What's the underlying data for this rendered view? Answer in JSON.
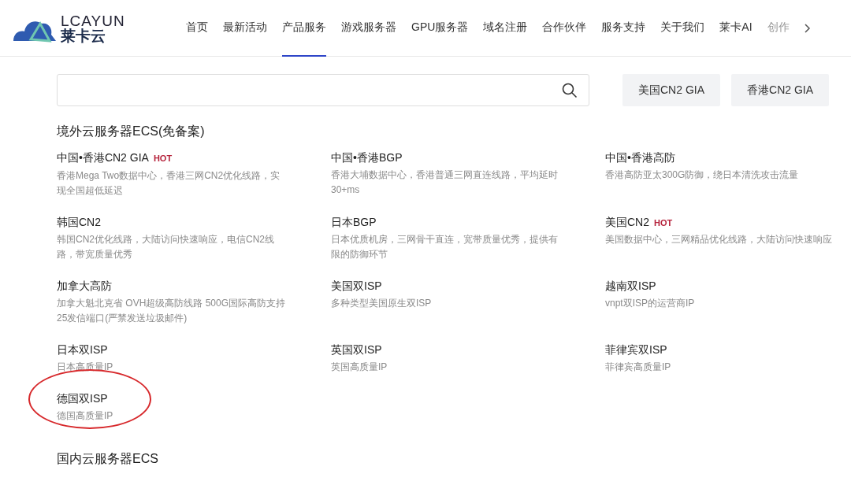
{
  "logo": {
    "latin": "LCAYUN",
    "chinese": "莱卡云"
  },
  "nav": [
    {
      "label": "首页",
      "selected": false
    },
    {
      "label": "最新活动",
      "selected": false
    },
    {
      "label": "产品服务",
      "selected": true
    },
    {
      "label": "游戏服务器",
      "selected": false
    },
    {
      "label": "GPU服务器",
      "selected": false
    },
    {
      "label": "域名注册",
      "selected": false
    },
    {
      "label": "合作伙伴",
      "selected": false
    },
    {
      "label": "服务支持",
      "selected": false
    },
    {
      "label": "关于我们",
      "selected": false
    },
    {
      "label": "莱卡AI",
      "selected": false
    },
    {
      "label": "创作",
      "selected": false
    }
  ],
  "search": {
    "quick_links": [
      "美国CN2 GIA",
      "香港CN2 GIA"
    ]
  },
  "sections": [
    {
      "title": "境外云服务器ECS(免备案)",
      "products": [
        {
          "name": "中国•香港CN2 GIA",
          "tag": "HOT",
          "description": "香港Mega Two数据中心，香港三网CN2优化线路，实现全国超低延迟"
        },
        {
          "name": "中国•香港BGP",
          "description": "香港大埔数据中心，香港普通三网直连线路，平均延时30+ms"
        },
        {
          "name": "中国•香港高防",
          "description": "香港高防亚太300G防御，绕日本清洗攻击流量"
        },
        {
          "name": "韩国CN2",
          "description": "韩国CN2优化线路，大陆访问快速响应，电信CN2线路，带宽质量优秀"
        },
        {
          "name": "日本BGP",
          "description": "日本优质机房，三网骨干直连，宽带质量优秀，提供有限的防御环节"
        },
        {
          "name": "美国CN2",
          "tag": "HOT",
          "description": "美国数据中心，三网精品优化线路，大陆访问快速响应"
        },
        {
          "name": "加拿大高防",
          "description": "加拿大魁北克省 OVH超级高防线路 500G国际高防支持25发信端口(严禁发送垃圾邮件)"
        },
        {
          "name": "美国双ISP",
          "description": "多种类型美国原生双ISP"
        },
        {
          "name": "越南双ISP",
          "description": "vnpt双ISP的运营商IP"
        },
        {
          "name": "日本双ISP",
          "description": "日本高质量IP"
        },
        {
          "name": "英国双ISP",
          "description": "英国高质量IP"
        },
        {
          "name": "菲律宾双ISP",
          "description": "菲律宾高质量IP"
        },
        {
          "name": "德国双ISP",
          "highlighted": true,
          "description": "德国高质量IP"
        }
      ]
    },
    {
      "title": "国内云服务器ECS"
    }
  ]
}
